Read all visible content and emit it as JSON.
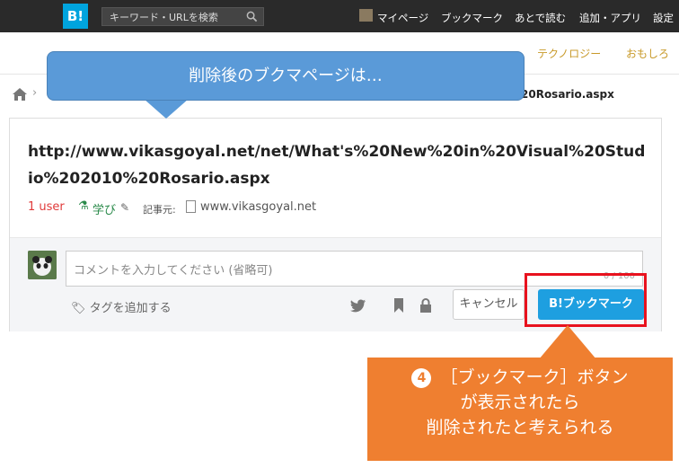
{
  "header": {
    "logo": "B!",
    "search_placeholder": "キーワード・URLを検索",
    "nav": [
      "マイページ",
      "ブックマーク",
      "あとで読む",
      "追加・アプリ",
      "設定"
    ]
  },
  "categories": [
    "テクノロジー",
    "おもしろ"
  ],
  "breadcrumb": {
    "current": "20Rosario.aspx"
  },
  "entry": {
    "url_title": "http://www.vikasgoyal.net/net/What's%20New%20in%20Visual%20Studio%202010%20Rosario.aspx",
    "users": "1 user",
    "category_tag": "学び",
    "source_label": "記事元:",
    "source_domain": "www.vikasgoyal.net"
  },
  "comment": {
    "placeholder": "コメントを入力してください (省略可)",
    "counter": "0 / 100",
    "add_tag": "タグを追加する",
    "cancel_label": "キャンセル",
    "bookmark_label": "B!ブックマーク"
  },
  "annotations": {
    "top_callout": "削除後のブクマページは…",
    "step_number": "4",
    "bottom_callout_line1": "［ブックマーク］ボタン",
    "bottom_callout_line2": "が表示されたら",
    "bottom_callout_line3": "削除されたと考えられる"
  },
  "colors": {
    "header_bg": "#2a2a2a",
    "brand": "#00a4de",
    "bookmark_button": "#1e9fe0",
    "highlight_frame": "#e8121e",
    "callout_blue": "#5a9ad8",
    "callout_orange": "#ef7f30"
  }
}
